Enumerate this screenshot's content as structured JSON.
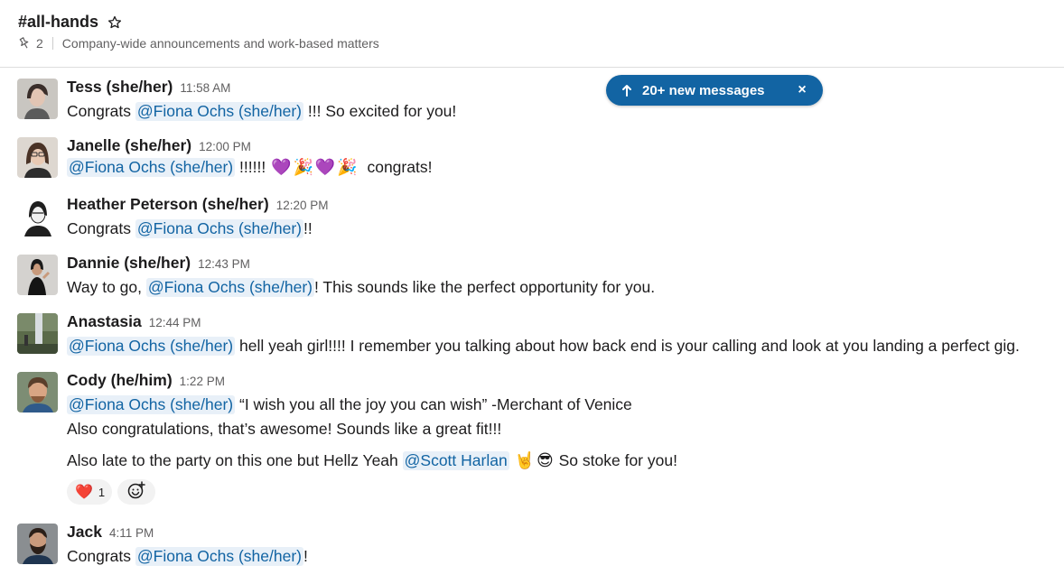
{
  "channel": {
    "name": "#all-hands",
    "pin_count": "2",
    "description": "Company-wide announcements and work-based matters"
  },
  "banner": {
    "label": "20+ new messages",
    "close": "×"
  },
  "messages": [
    {
      "sender": "Tess (she/her)",
      "time": "11:58 AM",
      "l1_pre": "Congrats ",
      "l1_mention": "@Fiona Ochs (she/her)",
      "l1_post": " !!! So excited for you!"
    },
    {
      "sender": "Janelle (she/her)",
      "time": "12:00 PM",
      "l1_mention": "@Fiona Ochs (she/her)",
      "l1_post": " !!!!!! ",
      "emojis": [
        "💜",
        "🎉",
        "💜",
        "🎉"
      ],
      "l1_end": "  congrats!"
    },
    {
      "sender": "Heather Peterson (she/her)",
      "time": "12:20 PM",
      "l1_pre": "Congrats ",
      "l1_mention": "@Fiona Ochs (she/her)",
      "l1_post": "!!"
    },
    {
      "sender": "Dannie (she/her)",
      "time": "12:43 PM",
      "l1_pre": "Way to go, ",
      "l1_mention": "@Fiona Ochs (she/her)",
      "l1_post": "! This sounds like the perfect opportunity for you."
    },
    {
      "sender": "Anastasia",
      "time": "12:44 PM",
      "l1_mention": "@Fiona Ochs (she/her)",
      "l1_post": " hell yeah girl!!!! I remember you talking about how back end is your calling and look at you landing a perfect gig."
    },
    {
      "sender": "Cody (he/him)",
      "time": "1:22 PM",
      "l1_mention": "@Fiona Ochs (she/her)",
      "l1_post": " “I wish you all the joy you can wish” -Merchant of Venice",
      "l2": "Also congratulations, that’s awesome! Sounds like a great fit!!!",
      "l3_pre": "Also late to the party on this one but Hellz Yeah ",
      "l3_mention": "@Scott Harlan",
      "l3_emojis": [
        "🤘",
        "😎"
      ],
      "l3_post": " So stoke for you!",
      "reaction": {
        "emoji": "❤️",
        "count": "1"
      }
    },
    {
      "sender": "Jack",
      "time": "4:11 PM",
      "l1_pre": "Congrats ",
      "l1_mention": "@Fiona Ochs (she/her)",
      "l1_post": "!"
    }
  ],
  "icons": {
    "star": "star-icon",
    "pin": "pin-icon",
    "arrow": "arrow-up-icon",
    "close": "close-icon",
    "add_reaction": "add-reaction-icon"
  },
  "colors": {
    "mention_bg": "#e8f0f8",
    "mention_text": "#1264a3",
    "banner": "#1264a3"
  }
}
